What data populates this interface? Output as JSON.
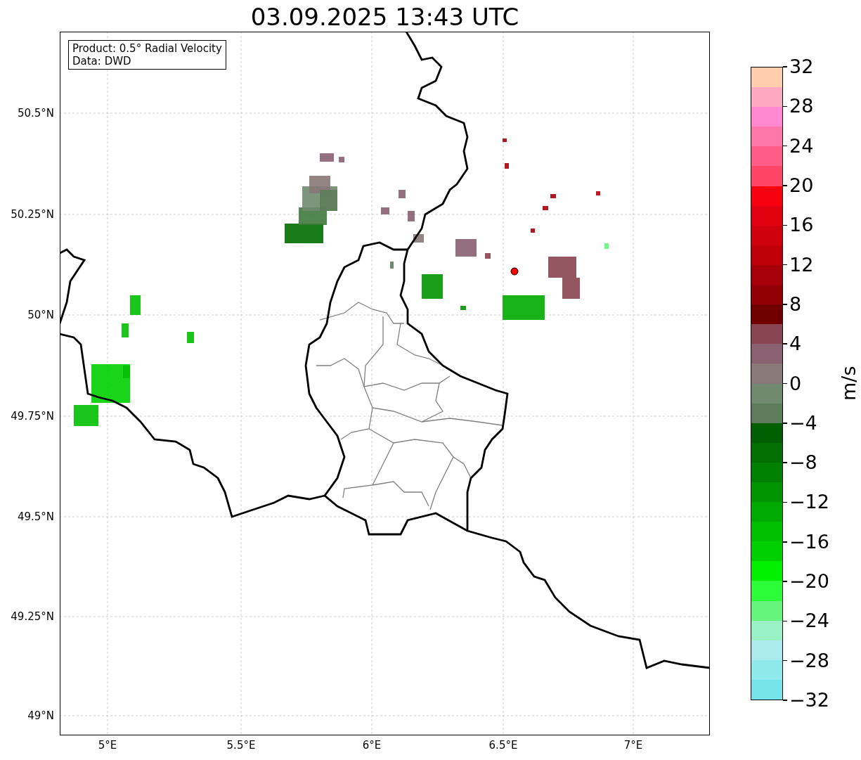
{
  "title": "03.09.2025 13:43 UTC",
  "map": {
    "info_box": [
      "Product: 0.5° Radial Velocity",
      "Data: DWD"
    ],
    "yticks": [
      "50.5°N",
      "50.25°N",
      "50°N",
      "49.75°N",
      "49.5°N",
      "49.25°N",
      "49°N"
    ],
    "xticks": [
      "5°E",
      "5.5°E",
      "6°E",
      "6.5°E",
      "7°E"
    ]
  },
  "colorbar": {
    "label": "m/s",
    "ticks": [
      "32",
      "28",
      "24",
      "20",
      "16",
      "12",
      "8",
      "4",
      "0",
      "−4",
      "−8",
      "−12",
      "−16",
      "−20",
      "−24",
      "−28",
      "−32"
    ],
    "bands": [
      {
        "color": "#ffcfad"
      },
      {
        "color": "#ffa8c4"
      },
      {
        "color": "#ff88d0"
      },
      {
        "color": "#ff77a8"
      },
      {
        "color": "#ff5c88"
      },
      {
        "color": "#ff4466"
      },
      {
        "color": "#f80010"
      },
      {
        "color": "#e0000e"
      },
      {
        "color": "#d0000c"
      },
      {
        "color": "#bf000a"
      },
      {
        "color": "#a80008"
      },
      {
        "color": "#920005"
      },
      {
        "color": "#700000"
      },
      {
        "color": "#884450"
      },
      {
        "color": "#886070"
      },
      {
        "color": "#887878"
      },
      {
        "color": "#6f8a6f"
      },
      {
        "color": "#5d7d5a"
      },
      {
        "color": "#005f00"
      },
      {
        "color": "#006e00"
      },
      {
        "color": "#008000"
      },
      {
        "color": "#009500"
      },
      {
        "color": "#00aa00"
      },
      {
        "color": "#00c000"
      },
      {
        "color": "#00d000"
      },
      {
        "color": "#00f000"
      },
      {
        "color": "#2cfd39"
      },
      {
        "color": "#66f57c"
      },
      {
        "color": "#9bf1c6"
      },
      {
        "color": "#aae9ee"
      },
      {
        "color": "#8ee9ec"
      },
      {
        "color": "#76e3e8"
      }
    ]
  }
}
